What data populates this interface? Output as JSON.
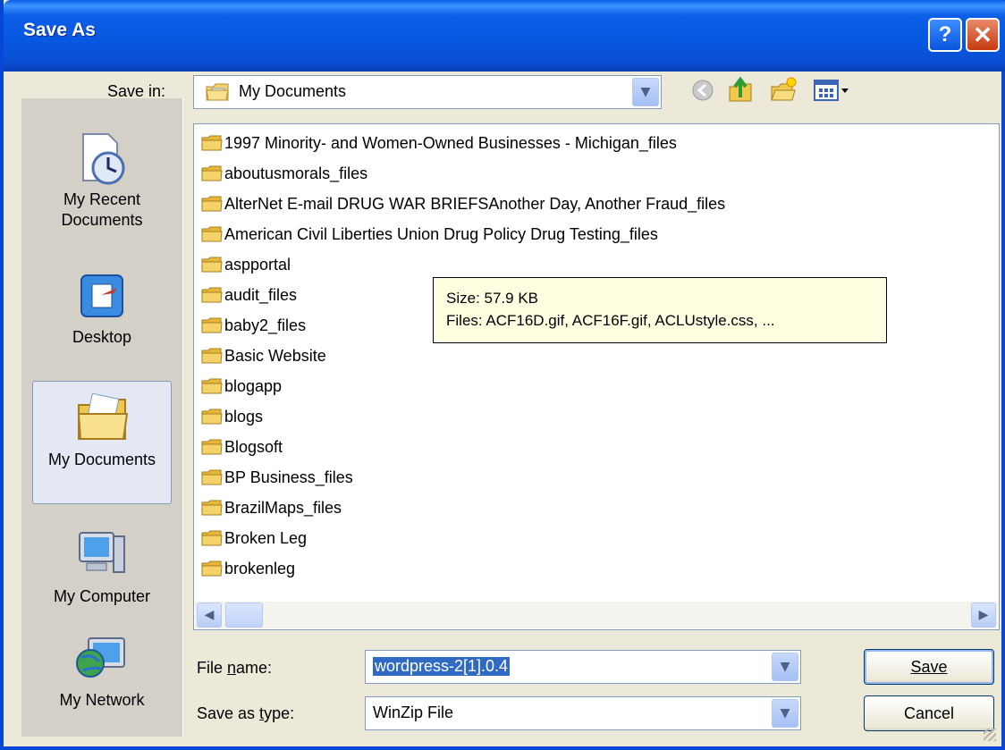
{
  "window": {
    "title": "Save As",
    "help_glyph": "?",
    "close_glyph": "✕"
  },
  "save_in": {
    "label": "Save in:",
    "value": "My Documents"
  },
  "toolbar_icons": [
    "back-icon",
    "up-folder-icon",
    "new-folder-icon",
    "views-menu-icon"
  ],
  "places": [
    {
      "label": "My Recent Documents",
      "icon": "recent-documents-icon"
    },
    {
      "label": "Desktop",
      "icon": "desktop-icon"
    },
    {
      "label": "My Documents",
      "icon": "my-documents-icon",
      "selected": true
    },
    {
      "label": "My Computer",
      "icon": "my-computer-icon"
    },
    {
      "label": "My Network",
      "icon": "my-network-icon"
    }
  ],
  "files": [
    "1997 Minority- and Women-Owned Businesses - Michigan_files",
    "aboutusmorals_files",
    "AlterNet E-mail DRUG WAR BRIEFSAnother Day, Another Fraud_files",
    "American Civil Liberties Union  Drug Policy  Drug Testing_files",
    "aspportal",
    "audit_files",
    "baby2_files",
    "Basic Website",
    "blogapp",
    "blogs",
    "Blogsoft",
    "BP Business_files",
    "BrazilMaps_files",
    "Broken Leg",
    "brokenleg"
  ],
  "tooltip": {
    "size": "Size: 57.9 KB",
    "files": "Files: ACF16D.gif, ACF16F.gif, ACLUstyle.css, ..."
  },
  "file_name": {
    "label": "File name:",
    "value": "wordpress-2[1].0.4"
  },
  "save_as_type": {
    "label": "Save as type:",
    "value": "WinZip File"
  },
  "buttons": {
    "save": "Save",
    "cancel": "Cancel"
  },
  "colors": {
    "title_bar": "#0a5fe8",
    "selection": "#316ac5",
    "tooltip_bg": "#ffffe1",
    "folder": "#f5d36b"
  }
}
